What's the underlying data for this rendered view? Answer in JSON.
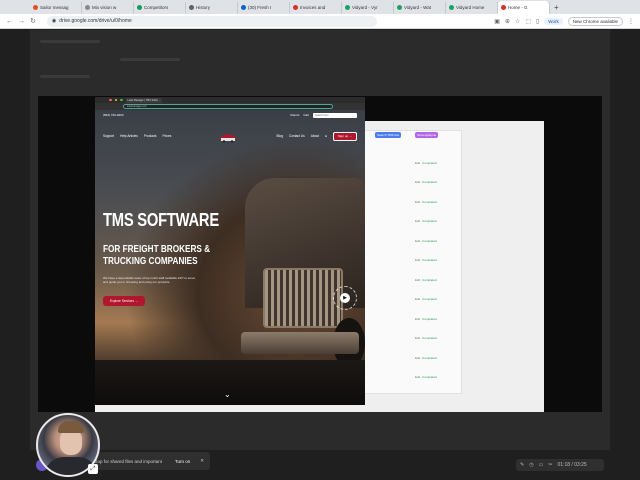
{
  "browser": {
    "tabs": [
      {
        "label": "Sailor messag",
        "color": "#e44d26"
      },
      {
        "label": "Mix vision w",
        "color": "#8a8a8a"
      },
      {
        "label": "Competitors",
        "color": "#0f9d58"
      },
      {
        "label": "History",
        "color": "#5f6368"
      },
      {
        "label": "(30) Fresh I",
        "color": "#0a66c2"
      },
      {
        "label": "Invoices and",
        "color": "#d93025"
      },
      {
        "label": "Vidyard - Vyr",
        "color": "#1aa260"
      },
      {
        "label": "Vidyard - Wat",
        "color": "#1aa260"
      },
      {
        "label": "Vidyard Home",
        "color": "#1aa260"
      },
      {
        "label": "Home - G",
        "color": "#d93025"
      }
    ],
    "new_tab": "+",
    "url": "drive.google.com/drive/u/0/home",
    "profile_label": "Work",
    "new_chrome": "New Chrome available"
  },
  "inner_browser": {
    "tab_label": "Load Manager | TMS Softw",
    "url": "loadmanager.com"
  },
  "site": {
    "phone": "(833) 726-9403",
    "top_links": [
      "Clients",
      "Cart"
    ],
    "search_placeholder": "Search here",
    "nav_left": [
      "Support",
      "Help Articles",
      "Products",
      "Prices"
    ],
    "nav_right": [
      "Blog",
      "Contact Us",
      "About"
    ],
    "signup": "Sign up →",
    "headline": "TMS SOFTWARE",
    "subheadline": "FOR FREIGHT BROKERS & TRUCKING COMPANIES",
    "description": "We have a dependable team of top notch staff available 24/7 to serve and guide you in choosing and using our products.",
    "cta": "Explore Services →",
    "play": "▶",
    "scroll_down": "⌄"
  },
  "doc_panel": {
    "chips": [
      {
        "label": "Search TMS tips",
        "color": "#4b7bec"
      },
      {
        "label": "Screenplayme",
        "color": "#b565e8"
      }
    ],
    "rows": [
      {
        "edit": "Edit",
        "status": "Completed"
      },
      {
        "edit": "Edit",
        "status": "Completed"
      },
      {
        "edit": "Edit",
        "status": "Completed"
      },
      {
        "edit": "Edit",
        "status": "Completed"
      },
      {
        "edit": "Edit",
        "status": "Completed"
      },
      {
        "edit": "Edit",
        "status": "Completed"
      },
      {
        "edit": "Edit",
        "status": "Completed"
      },
      {
        "edit": "Edit",
        "status": "Completed"
      },
      {
        "edit": "Edit",
        "status": "Completed"
      },
      {
        "edit": "Edit",
        "status": "Completed"
      },
      {
        "edit": "Edit",
        "status": "Completed"
      },
      {
        "edit": "Edit",
        "status": "Completed"
      }
    ]
  },
  "bottom": {
    "toast_text": "ktop for shared files and important",
    "turn_on": "Turn on",
    "close": "✕",
    "controls": [
      "✎",
      "◷",
      "▭",
      "✂",
      "01:18 / 03:25"
    ]
  }
}
